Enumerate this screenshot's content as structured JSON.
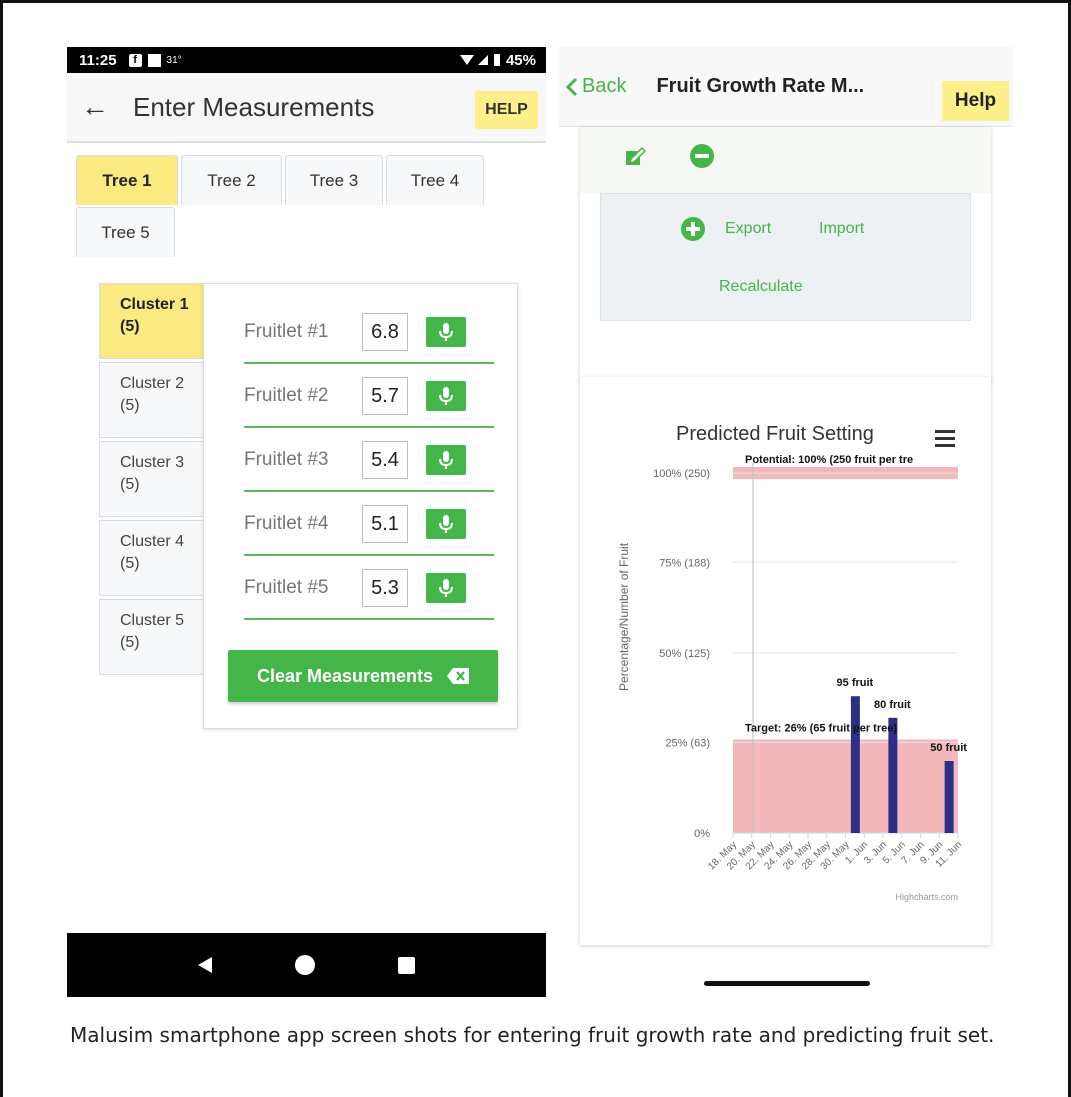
{
  "left_phone": {
    "status": {
      "time": "11:25",
      "temp": "31°",
      "battery": "45%"
    },
    "appbar": {
      "back_icon": "back-arrow-icon",
      "title": "Enter Measurements",
      "help": "HELP"
    },
    "tabs": [
      "Tree 1",
      "Tree 2",
      "Tree 3",
      "Tree 4",
      "Tree 5"
    ],
    "active_tab": "Tree 1",
    "clusters": [
      {
        "name": "Cluster 1",
        "count": "(5)"
      },
      {
        "name": "Cluster 2",
        "count": "(5)"
      },
      {
        "name": "Cluster 3",
        "count": "(5)"
      },
      {
        "name": "Cluster 4",
        "count": "(5)"
      },
      {
        "name": "Cluster 5",
        "count": "(5)"
      }
    ],
    "fruitlets": [
      {
        "label": "Fruitlet #1",
        "value": "6.8"
      },
      {
        "label": "Fruitlet #2",
        "value": "5.7"
      },
      {
        "label": "Fruitlet #3",
        "value": "5.4"
      },
      {
        "label": "Fruitlet #4",
        "value": "5.1"
      },
      {
        "label": "Fruitlet #5",
        "value": "5.3"
      }
    ],
    "clear_button": "Clear Measurements"
  },
  "right_phone": {
    "appbar": {
      "back": "Back",
      "title": "Fruit Growth Rate M...",
      "help": "Help"
    },
    "actions": {
      "export": "Export",
      "import": "Import",
      "recalculate": "Recalculate"
    }
  },
  "chart_data": {
    "type": "bar",
    "title": "Predicted Fruit Setting",
    "ylabel": "Percentage/Number of Fruit",
    "yticks": [
      "0%",
      "25% (63)",
      "50% (125)",
      "75% (188)",
      "100% (250)"
    ],
    "ylim": [
      0,
      250
    ],
    "xticks": [
      "18. May",
      "20. May",
      "22. May",
      "24. May",
      "26. May",
      "28. May",
      "30. May",
      "1. Jun",
      "3. Jun",
      "5. Jun",
      "7. Jun",
      "9. Jun",
      "11. Jun"
    ],
    "bars": [
      {
        "x": "31. May",
        "value": 95,
        "label": "95 fruit"
      },
      {
        "x": "4. Jun",
        "value": 80,
        "label": "80 fruit"
      },
      {
        "x": "10. Jun",
        "value": 50,
        "label": "50 fruit"
      }
    ],
    "potential_band": {
      "value": 250,
      "label": "Potential: 100% (250 fruit per tre"
    },
    "target_band": {
      "value": 65,
      "label": "Target: 26% (65 fruit per tree)"
    },
    "credit": "Highcharts.com",
    "colors": {
      "bar": "#2b2f86",
      "band": "#f4b8bb"
    }
  },
  "caption": "Malusim smartphone app screen shots for entering fruit growth rate and predicting fruit set."
}
